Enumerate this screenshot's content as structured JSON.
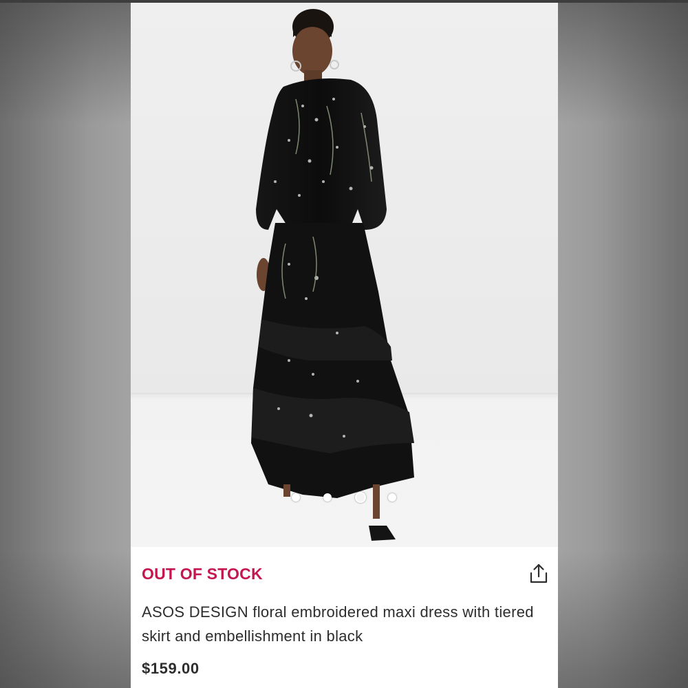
{
  "product": {
    "stock_status": "OUT OF STOCK",
    "title": "ASOS DESIGN floral embroidered maxi dress with tiered skirt and embellishment in black",
    "price": "$159.00"
  },
  "gallery": {
    "image_count": 4,
    "active_index": 2
  },
  "icons": {
    "share": "share-icon"
  },
  "colors": {
    "stock_status": "#c4174f",
    "text": "#2d2d2d",
    "background": "#ffffff"
  }
}
